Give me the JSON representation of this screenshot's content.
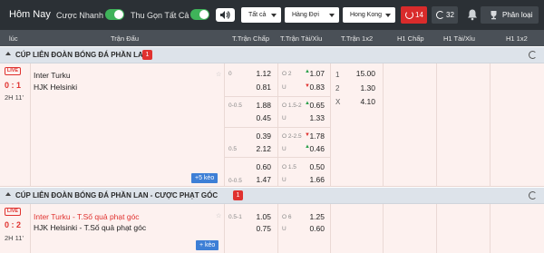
{
  "header": {
    "title": "Hôm Nay",
    "toggle_fast": "Cược Nhanh",
    "toggle_collapse": "Thu Gọn Tất Cả",
    "filter_all": "Tất cả",
    "sort": "Hàng Đợi",
    "region": "Hong Kong",
    "live_count": "14",
    "refresh_count": "32",
    "classify": "Phân loại",
    "accent_live": "#d92b2b",
    "accent_toggle": "#3fb35a"
  },
  "columns": {
    "time": "lúc",
    "match": "Trận Đấu",
    "ft_hdp": "T.Trận Chấp",
    "ft_ou": "T.Trận Tài/Xỉu",
    "ft_1x2": "T.Trận 1x2",
    "h1_hdp": "H1 Chấp",
    "h1_ou": "H1 Tài/Xỉu",
    "h1_1x2": "H1 1x2"
  },
  "sections": [
    {
      "name": "CÚP LIÊN ĐOÀN BÓNG ĐÁ PHẦN LAN",
      "badge": "1",
      "match": {
        "live_tag": "LIVE",
        "score": "0 : 1",
        "time": "2H 11'",
        "home": "Inter Turku",
        "away": "HJK Helsinki",
        "more": "+5 kèo",
        "rows": [
          {
            "hdp_line": "0",
            "hdp_home": "1.12",
            "hdp_away": "0.81",
            "ou_over_lbl": "O 2",
            "ou_over": "1.07",
            "ou_under_lbl": "U",
            "ou_under": "0.83"
          },
          {
            "hdp_line": "0-0.5",
            "hdp_home": "1.88",
            "hdp_away": "0.45",
            "ou_over_lbl": "O 1.5-2",
            "ou_over": "0.65",
            "ou_under_lbl": "U",
            "ou_under": "1.33"
          },
          {
            "hdp_line": "0.5",
            "hdp_home": "0.39",
            "hdp_away": "2.12",
            "ou_over_lbl": "O 2-2.5",
            "ou_over": "1.78",
            "ou_under_lbl": "U",
            "ou_under": "0.46"
          },
          {
            "hdp_line": "0-0.5",
            "hdp_home": "0.60",
            "hdp_away": "1.47",
            "ou_over_lbl": "O 1.5",
            "ou_over": "0.50",
            "ou_under_lbl": "U",
            "ou_under": "1.66"
          }
        ],
        "x12": [
          {
            "label": "1",
            "value": "15.00"
          },
          {
            "label": "2",
            "value": "1.30"
          },
          {
            "label": "X",
            "value": "4.10"
          }
        ]
      }
    },
    {
      "name": "CÚP LIÊN ĐOÀN BÓNG ĐÁ PHẦN LAN - CƯỢC PHẠT GÓC",
      "badge": "1",
      "match": {
        "live_tag": "LIVE",
        "score": "0 : 2",
        "time": "2H 11'",
        "home": "Inter Turku - T.Số quả phạt góc",
        "away": "HJK Helsinki - T.Số quả phạt góc",
        "more": "+ kèo",
        "rows": [
          {
            "hdp_line": "0.5-1",
            "hdp_home": "1.05",
            "hdp_away": "0.75",
            "ou_over_lbl": "O 6",
            "ou_over": "1.25",
            "ou_under_lbl": "U",
            "ou_under": "0.60"
          }
        ]
      }
    }
  ]
}
